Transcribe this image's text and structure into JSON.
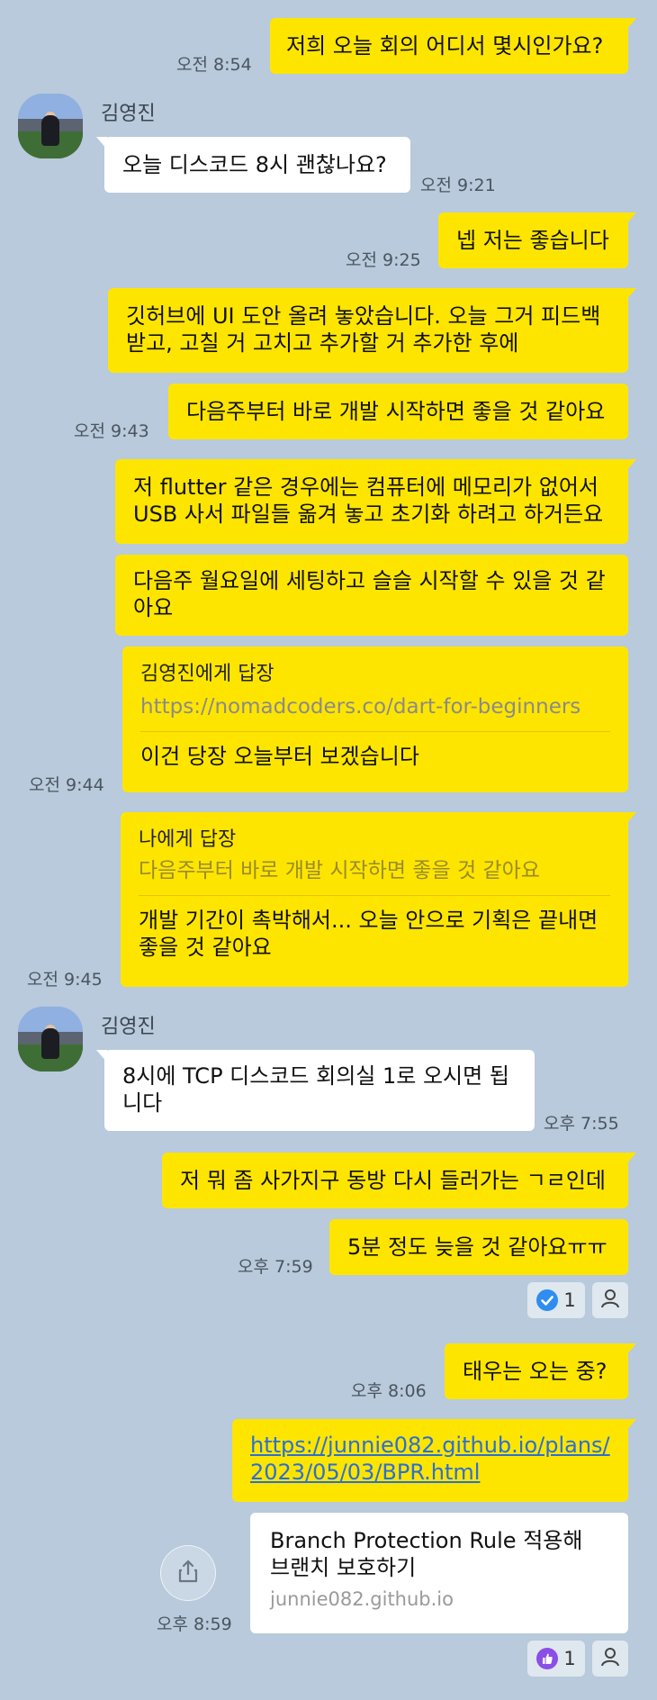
{
  "messages": {
    "m1": {
      "text": "저희 오늘 회의 어디서 몇시인가요?",
      "time": "오전 8:54"
    },
    "sender1": {
      "name": "김영진"
    },
    "m2": {
      "text": "오늘 디스코드 8시 괜찮나요?",
      "time": "오전 9:21"
    },
    "m3": {
      "text": "넵 저는 좋습니다",
      "time": "오전 9:25"
    },
    "m4": {
      "text": "깃허브에 UI 도안 올려 놓았습니다. 오늘 그거 피드백 받고, 고칠 거 고치고 추가할 거 추가한 후에"
    },
    "m5": {
      "text": "다음주부터 바로 개발 시작하면 좋을 것 같아요",
      "time": "오전 9:43"
    },
    "m6": {
      "text": "저 flutter 같은 경우에는 컴퓨터에 메모리가 없어서 USB 사서 파일들 옮겨 놓고 초기화 하려고 하거든요"
    },
    "m7": {
      "text": "다음주 월요일에 세팅하고 슬슬 시작할 수 있을 것 같아요"
    },
    "m8": {
      "reply_to": "김영진에게 답장",
      "quote": "https://nomadcoders.co/dart-for-beginners",
      "text": "이건 당장 오늘부터 보겠습니다",
      "time": "오전 9:44"
    },
    "m9": {
      "reply_to": "나에게 답장",
      "quote": "다음주부터 바로 개발 시작하면 좋을 것 같아요",
      "text": "개발 기간이 촉박해서... 오늘 안으로 기획은 끝내면 좋을 것 같아요",
      "time": "오전 9:45"
    },
    "sender2": {
      "name": "김영진"
    },
    "m10": {
      "text": "8시에 TCP 디스코드 회의실 1로 오시면 됩니다",
      "time": "오후 7:55"
    },
    "m11": {
      "text": "저 뭐 좀 사가지구 동방 다시 들러가는 ㄱㄹ인데"
    },
    "m12": {
      "text": "5분 정도 늦을 것 같아요ㅠㅠ",
      "time": "오후 7:59"
    },
    "reaction1": {
      "icon": "check-icon",
      "count": "1"
    },
    "m13": {
      "text": "태우는 오는 중?",
      "time": "오후 8:06"
    },
    "m14": {
      "link": "https://junnie082.github.io/plans/2023/05/03/BPR.html"
    },
    "preview": {
      "title": "Branch Protection Rule 적용해 브랜치 보호하기",
      "domain": "junnie082.github.io",
      "time": "오후 8:59"
    },
    "reaction2": {
      "icon": "thumbs-up-icon",
      "count": "1"
    }
  },
  "colors": {
    "background": "#b8cadb",
    "my_bubble": "#fee500",
    "their_bubble": "#ffffff",
    "link": "#2a6fd6",
    "check_badge": "#2f8df0",
    "like_badge": "#8a4fe6"
  }
}
